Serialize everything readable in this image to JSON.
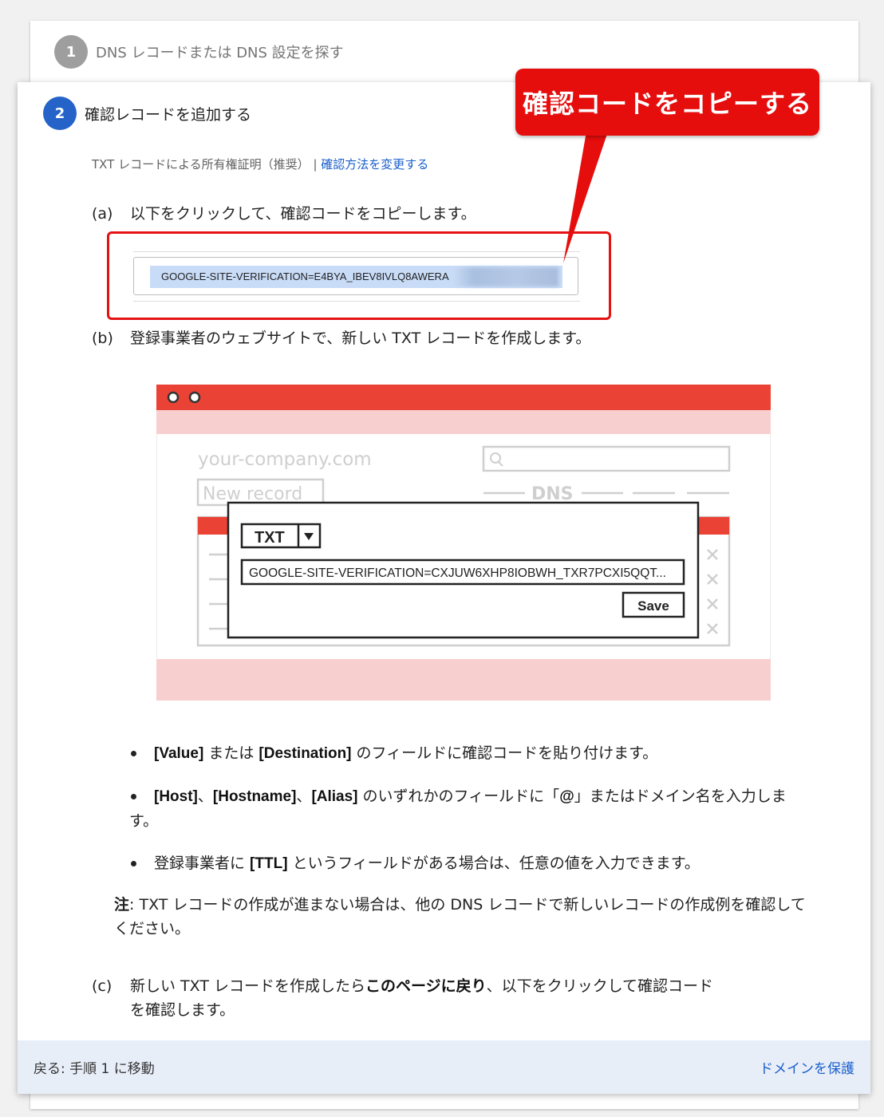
{
  "step1": {
    "number": "1",
    "title": "DNS レコードまたは DNS 設定を探す"
  },
  "step2": {
    "number": "2",
    "title": "確認レコードを追加する",
    "method_text": "TXT レコードによる所有権証明（推奨）",
    "method_separator": " | ",
    "method_link": "確認方法を変更する",
    "a_label": "(a)",
    "a_text": "以下をクリックして、確認コードをコピーします。",
    "verification_code": "GOOGLE-SITE-VERIFICATION=E4BYA_IBEV8IVLQ8AWERA",
    "b_label": "(b)",
    "b_text": "登録事業者のウェブサイトで、新しい TXT レコードを作成します。",
    "illustration": {
      "domain": "your-company.com",
      "new_record": "New record",
      "dns": "DNS",
      "record_type": "TXT",
      "record_value": "GOOGLE-SITE-VERIFICATION=CXJUW6XHP8IOBWH_TXR7PCXI5QQT...",
      "save": "Save"
    },
    "bullets": {
      "b1": {
        "k1": "[Value]",
        "t1": " または ",
        "k2": "[Destination]",
        "t2": " のフィールドに確認コードを貼り付けます。"
      },
      "b2": {
        "k1": "[Host]",
        "t1": "、",
        "k2": "[Hostname]",
        "t2": "、",
        "k3": "[Alias]",
        "t3": " のいずれかのフィールドに「",
        "k4": "@",
        "t4": "」またはドメイン名を入力します。"
      },
      "b3": {
        "t1": "登録事業者に ",
        "k1": "[TTL]",
        "t2": " というフィールドがある場合は、任意の値を入力できます。"
      }
    },
    "note": {
      "label": "注",
      "text": ": TXT レコードの作成が進まない場合は、他の DNS レコードで新しいレコードの作成例を確認してください。"
    },
    "c_label": "(c)",
    "c_text1": "新しい TXT レコードを作成したら",
    "c_bold": "このページに戻り",
    "c_text2": "、以下をクリックして確認コード",
    "c_text3": "を確認します。"
  },
  "footer": {
    "back": "戻る: 手順 1 に移動",
    "protect": "ドメインを保護"
  },
  "callout": "確認コードをコピーする",
  "colors": {
    "accent_red": "#e60d0d",
    "link_blue": "#1a5fcc",
    "step_blue": "#2563c9",
    "footer_bg": "#e8eef8"
  },
  "icons": {
    "search": "search-icon",
    "dropdown": "dropdown-icon",
    "delete": "close-icon"
  }
}
